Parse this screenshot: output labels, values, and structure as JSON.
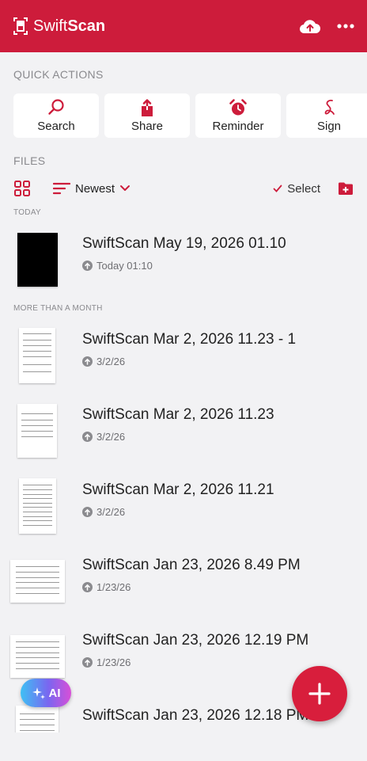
{
  "header": {
    "brand_light": "Swift",
    "brand_bold": "Scan",
    "icons": [
      "swiftscan-logo-icon",
      "cloud-upload-icon",
      "more-dots-icon"
    ]
  },
  "quick_actions": {
    "title": "QUICK ACTIONS",
    "items": [
      {
        "label": "Search",
        "icon": "search-icon"
      },
      {
        "label": "Share",
        "icon": "share-icon"
      },
      {
        "label": "Reminder",
        "icon": "alarm-clock-icon"
      },
      {
        "label": "Sign",
        "icon": "signature-icon"
      }
    ]
  },
  "files": {
    "title": "FILES",
    "sort_label": "Newest",
    "select_label": "Select",
    "groups": [
      {
        "label": "TODAY"
      },
      {
        "label": "MORE THAN A MONTH"
      }
    ],
    "items": [
      {
        "name": "SwiftScan May 19, 2026 01.10",
        "meta": "Today 01:10"
      },
      {
        "name": "SwiftScan Mar 2, 2026 11.23 - 1",
        "meta": "3/2/26"
      },
      {
        "name": "SwiftScan Mar 2, 2026 11.23",
        "meta": "3/2/26"
      },
      {
        "name": "SwiftScan Mar 2, 2026 11.21",
        "meta": "3/2/26"
      },
      {
        "name": "SwiftScan Jan 23, 2026 8.49 PM",
        "meta": "1/23/26"
      },
      {
        "name": "SwiftScan Jan 23, 2026 12.19 PM",
        "meta": "1/23/26"
      },
      {
        "name": "SwiftScan Jan 23, 2026 12.18 PM",
        "meta": ""
      }
    ]
  },
  "ai_button": {
    "label": "AI"
  },
  "colors": {
    "accent": "#cd1c3b",
    "fab": "#d81e3c",
    "background": "#f2f2f4"
  }
}
